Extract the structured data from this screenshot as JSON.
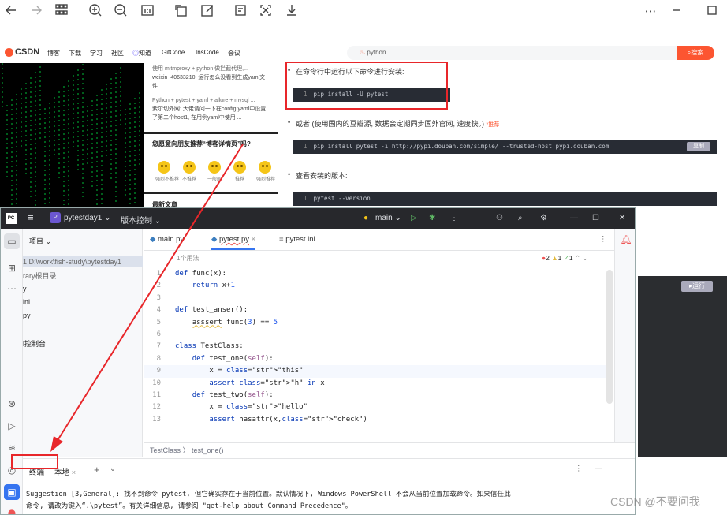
{
  "viewer": {
    "icons": [
      "back-icon",
      "forward-icon",
      "grid-icon",
      "zoom-in-icon",
      "zoom-out-icon",
      "actual-size-icon",
      "rotate-icon",
      "edit-icon",
      "ocr-icon",
      "crop-icon",
      "download-icon",
      "more-icon",
      "minimize-icon",
      "maximize-icon"
    ]
  },
  "csdn": {
    "logo": "CSDN",
    "nav": [
      "博客",
      "下载",
      "学习",
      "社区",
      "知道",
      "GitCode",
      "InsCode",
      "会议"
    ],
    "search_value": "python",
    "search_button": "搜索"
  },
  "sidebar": {
    "card1_line1": "使用 mitmproxy + python 做拦截代理,...",
    "card1_line2": "weixin_40633210: 运行怎么没看到生成yaml文件",
    "card2_line1": "Python + pytest + yaml + allure + mysql ...",
    "card2_line2": "紫尔切外网: 大佬请问一下在config.yaml中设置了第二个host1, 在用例yaml中使用 ...",
    "feedback_title": "您愿意向朋友推荐“博客详情页”吗?",
    "emojis": [
      "强烈不推荐",
      "不推荐",
      "一般般",
      "推荐",
      "强烈推荐"
    ],
    "recent_title": "最新文章"
  },
  "article": {
    "bullet1": "在命令行中运行以下命令进行安装:",
    "code1": "pip install -U pytest",
    "bullet2": "或者 (使用国内的豆瓣源, 数据会定期同步国外官网, 速度快。)",
    "bullet2_badge": "*推荐",
    "code2": "pip install pytest -i http://pypi.douban.com/simple/ --trusted-host pypi.douban.com",
    "copy": "复制",
    "bullet3": "查看安装的版本:",
    "code3": "pytest --version",
    "run": "运行",
    "line_no": "1"
  },
  "ide": {
    "logo": "PC",
    "project_badge": "P",
    "project_name": "pytestday1",
    "vcs": "版本控制",
    "branch": "main",
    "panel_title": "项目",
    "tree": [
      "1 D:\\work\\fish-study\\pytestday1",
      "rary根目录",
      "y",
      "ini",
      "py",
      "l控制台"
    ],
    "tabs": [
      "main.py",
      "pytest.py",
      "pytest.ini"
    ],
    "usages": "1个用法",
    "inspections": {
      "errors": "2",
      "warnings": "1",
      "ok": "1"
    },
    "code": [
      {
        "n": "1",
        "t": "def func(x):"
      },
      {
        "n": "2",
        "t": "    return x+1"
      },
      {
        "n": "3",
        "t": ""
      },
      {
        "n": "4",
        "t": "def test_anser():"
      },
      {
        "n": "5",
        "t": "    asssert func(3) == 5"
      },
      {
        "n": "6",
        "t": ""
      },
      {
        "n": "7",
        "t": "class TestClass:"
      },
      {
        "n": "8",
        "t": "    def test_one(self):"
      },
      {
        "n": "9",
        "t": "        x = \"this\""
      },
      {
        "n": "10",
        "t": "        assert \"h\" in x"
      },
      {
        "n": "11",
        "t": "    def test_two(self):"
      },
      {
        "n": "12",
        "t": "        x = \"hello\""
      },
      {
        "n": "13",
        "t": "        assert hasattr(x,\"check\")"
      }
    ],
    "breadcrumb": [
      "TestClass",
      "test_one()"
    ],
    "terminal_tabs": [
      "终端",
      "本地"
    ],
    "terminal_lines": [
      "Suggestion [3,General]: 找不到命令 pytest, 但它确实存在于当前位置。默认情况下, Windows PowerShell 不会从当前位置加载命令。如果信任此",
      "命令, 请改为键入“.\\pytest”。有关详细信息, 请参阅 \"get-help about_Command_Precedence\"。"
    ]
  },
  "watermark": "CSDN @不要问我"
}
